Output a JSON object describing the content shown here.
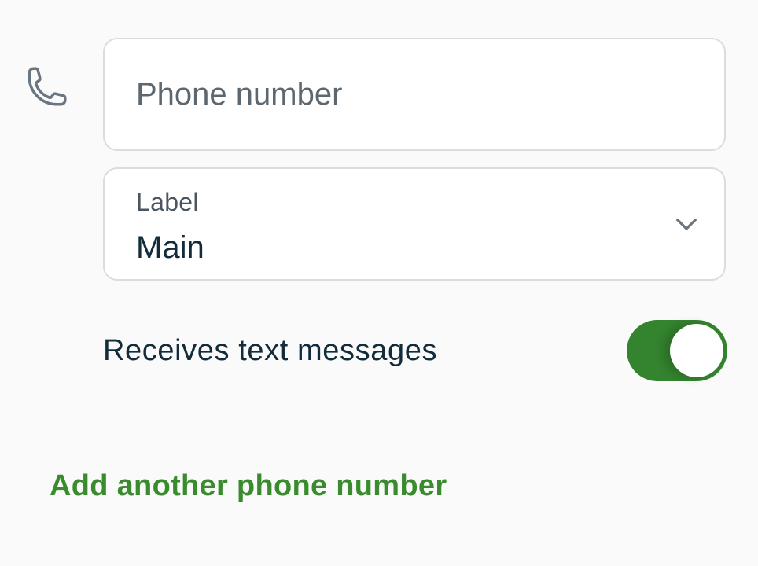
{
  "phone_field": {
    "icon": "phone-icon",
    "placeholder": "Phone number",
    "value": ""
  },
  "label_select": {
    "caption": "Label",
    "selected": "Main",
    "icon": "chevron-down-icon"
  },
  "text_toggle": {
    "label": "Receives text messages",
    "checked": true
  },
  "add_link": {
    "label": "Add another phone number"
  },
  "colors": {
    "accent": "#3a8a2e",
    "toggle_on": "#34832e",
    "field_border": "#dcdcdc",
    "text_primary": "#132c3a",
    "text_secondary": "#5c6770",
    "background": "#fafafa"
  }
}
